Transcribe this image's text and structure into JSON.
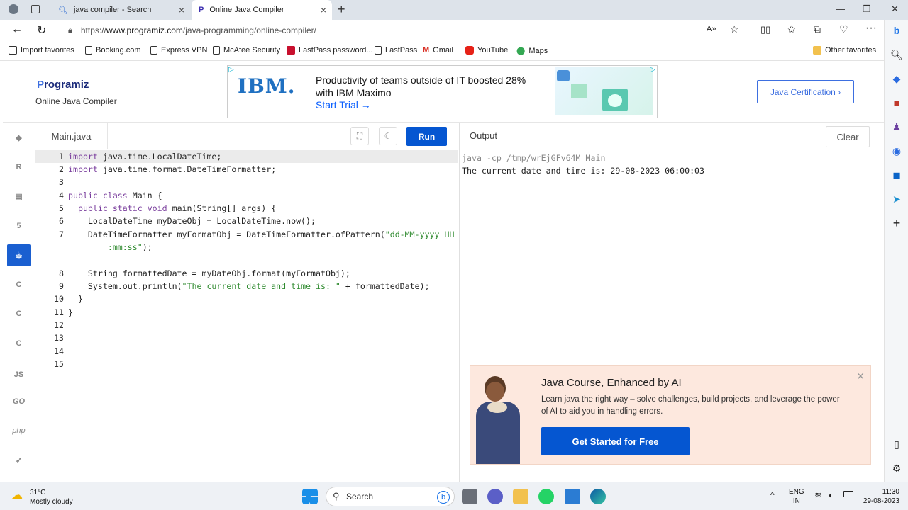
{
  "browser": {
    "tabs": [
      {
        "title": "java compiler - Search",
        "active": false
      },
      {
        "title": "Online Java Compiler",
        "active": true
      }
    ],
    "url_prefix": "https://",
    "url_domain": "www.programiz.com",
    "url_path": "/java-programming/online-compiler/",
    "favorites": [
      {
        "label": "Import favorites",
        "icon": "import-icon"
      },
      {
        "label": "Booking.com",
        "icon": "page-icon"
      },
      {
        "label": "Express VPN",
        "icon": "page-icon"
      },
      {
        "label": "McAfee Security",
        "icon": "mcafee-icon"
      },
      {
        "label": "LastPass password...",
        "icon": "lastpass-icon"
      },
      {
        "label": "LastPass",
        "icon": "page-icon"
      },
      {
        "label": "Gmail",
        "icon": "gmail-icon"
      },
      {
        "label": "YouTube",
        "icon": "youtube-icon"
      },
      {
        "label": "Maps",
        "icon": "maps-icon"
      }
    ],
    "other_favorites": "Other favorites"
  },
  "site": {
    "logo_p": "P",
    "logo_rest": "rogramiz",
    "subtitle": "Online Java Compiler",
    "ad": {
      "brand": "IBM.",
      "text": "Productivity of teams outside of IT boosted 28% with IBM Maximo",
      "cta": "Start Trial →"
    },
    "cert_button": "Java Certification ›"
  },
  "languages": [
    "python",
    "r",
    "sql",
    "html",
    "java",
    "c",
    "cpp",
    "csharp",
    "JS",
    "GO",
    "php",
    "swift"
  ],
  "editor": {
    "file_name": "Main.java",
    "run_label": "Run",
    "line_numbers": [
      "1",
      "2",
      "3",
      "4",
      "5",
      "6",
      "7",
      "",
      "8",
      "9",
      "10",
      "11",
      "12",
      "13",
      "14",
      "15"
    ]
  },
  "output": {
    "title": "Output",
    "clear_label": "Clear",
    "command": "java -cp /tmp/wrEjGFv64M Main",
    "result": "The current date and time is: 29-08-2023 06:00:03"
  },
  "promo": {
    "title": "Java Course, Enhanced by AI",
    "description": "Learn java the right way – solve challenges, build projects, and leverage the power of AI to aid you in handling errors.",
    "button": "Get Started for Free"
  },
  "taskbar": {
    "temp": "31°C",
    "weather": "Mostly cloudy",
    "search_placeholder": "Search",
    "lang1": "ENG",
    "lang2": "IN",
    "time": "11:30",
    "date": "29-08-2023"
  },
  "colors": {
    "accent": "#0556d1",
    "promo_bg": "#fde8de"
  }
}
